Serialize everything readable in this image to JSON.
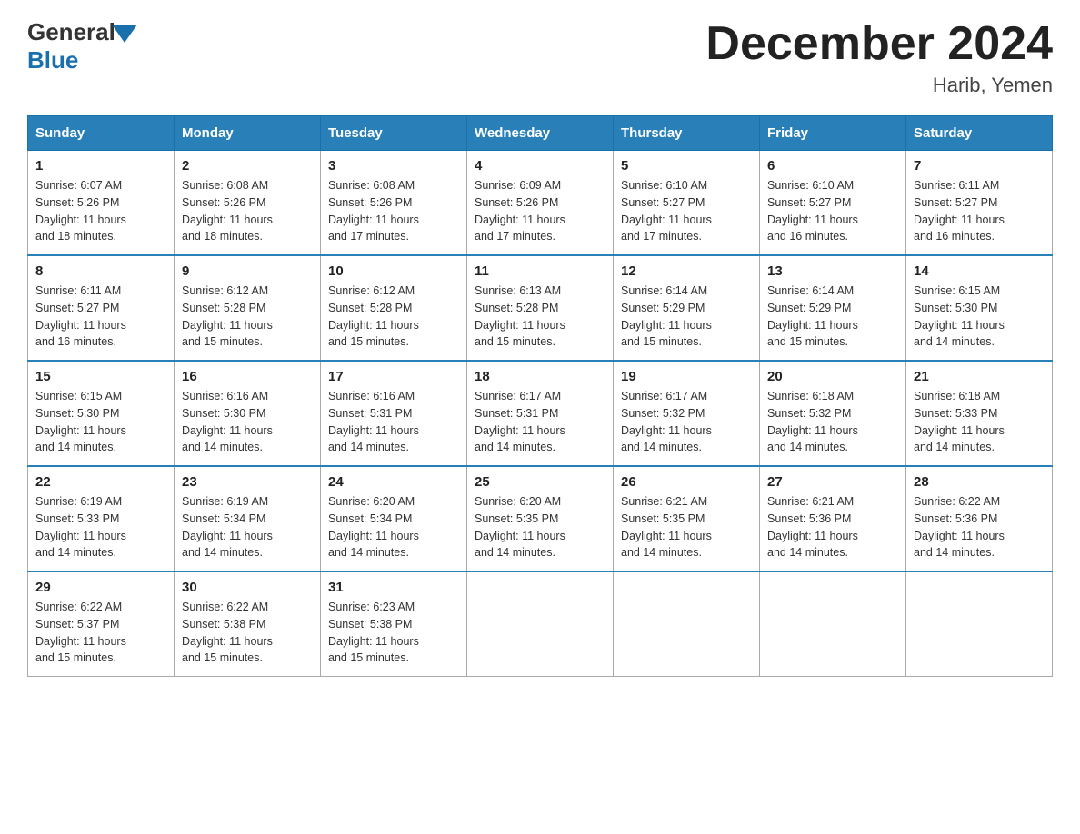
{
  "logo": {
    "general": "General",
    "blue": "Blue"
  },
  "title": "December 2024",
  "subtitle": "Harib, Yemen",
  "days_of_week": [
    "Sunday",
    "Monday",
    "Tuesday",
    "Wednesday",
    "Thursday",
    "Friday",
    "Saturday"
  ],
  "weeks": [
    [
      {
        "day": "1",
        "sunrise": "6:07 AM",
        "sunset": "5:26 PM",
        "daylight": "11 hours and 18 minutes."
      },
      {
        "day": "2",
        "sunrise": "6:08 AM",
        "sunset": "5:26 PM",
        "daylight": "11 hours and 18 minutes."
      },
      {
        "day": "3",
        "sunrise": "6:08 AM",
        "sunset": "5:26 PM",
        "daylight": "11 hours and 17 minutes."
      },
      {
        "day": "4",
        "sunrise": "6:09 AM",
        "sunset": "5:26 PM",
        "daylight": "11 hours and 17 minutes."
      },
      {
        "day": "5",
        "sunrise": "6:10 AM",
        "sunset": "5:27 PM",
        "daylight": "11 hours and 17 minutes."
      },
      {
        "day": "6",
        "sunrise": "6:10 AM",
        "sunset": "5:27 PM",
        "daylight": "11 hours and 16 minutes."
      },
      {
        "day": "7",
        "sunrise": "6:11 AM",
        "sunset": "5:27 PM",
        "daylight": "11 hours and 16 minutes."
      }
    ],
    [
      {
        "day": "8",
        "sunrise": "6:11 AM",
        "sunset": "5:27 PM",
        "daylight": "11 hours and 16 minutes."
      },
      {
        "day": "9",
        "sunrise": "6:12 AM",
        "sunset": "5:28 PM",
        "daylight": "11 hours and 15 minutes."
      },
      {
        "day": "10",
        "sunrise": "6:12 AM",
        "sunset": "5:28 PM",
        "daylight": "11 hours and 15 minutes."
      },
      {
        "day": "11",
        "sunrise": "6:13 AM",
        "sunset": "5:28 PM",
        "daylight": "11 hours and 15 minutes."
      },
      {
        "day": "12",
        "sunrise": "6:14 AM",
        "sunset": "5:29 PM",
        "daylight": "11 hours and 15 minutes."
      },
      {
        "day": "13",
        "sunrise": "6:14 AM",
        "sunset": "5:29 PM",
        "daylight": "11 hours and 15 minutes."
      },
      {
        "day": "14",
        "sunrise": "6:15 AM",
        "sunset": "5:30 PM",
        "daylight": "11 hours and 14 minutes."
      }
    ],
    [
      {
        "day": "15",
        "sunrise": "6:15 AM",
        "sunset": "5:30 PM",
        "daylight": "11 hours and 14 minutes."
      },
      {
        "day": "16",
        "sunrise": "6:16 AM",
        "sunset": "5:30 PM",
        "daylight": "11 hours and 14 minutes."
      },
      {
        "day": "17",
        "sunrise": "6:16 AM",
        "sunset": "5:31 PM",
        "daylight": "11 hours and 14 minutes."
      },
      {
        "day": "18",
        "sunrise": "6:17 AM",
        "sunset": "5:31 PM",
        "daylight": "11 hours and 14 minutes."
      },
      {
        "day": "19",
        "sunrise": "6:17 AM",
        "sunset": "5:32 PM",
        "daylight": "11 hours and 14 minutes."
      },
      {
        "day": "20",
        "sunrise": "6:18 AM",
        "sunset": "5:32 PM",
        "daylight": "11 hours and 14 minutes."
      },
      {
        "day": "21",
        "sunrise": "6:18 AM",
        "sunset": "5:33 PM",
        "daylight": "11 hours and 14 minutes."
      }
    ],
    [
      {
        "day": "22",
        "sunrise": "6:19 AM",
        "sunset": "5:33 PM",
        "daylight": "11 hours and 14 minutes."
      },
      {
        "day": "23",
        "sunrise": "6:19 AM",
        "sunset": "5:34 PM",
        "daylight": "11 hours and 14 minutes."
      },
      {
        "day": "24",
        "sunrise": "6:20 AM",
        "sunset": "5:34 PM",
        "daylight": "11 hours and 14 minutes."
      },
      {
        "day": "25",
        "sunrise": "6:20 AM",
        "sunset": "5:35 PM",
        "daylight": "11 hours and 14 minutes."
      },
      {
        "day": "26",
        "sunrise": "6:21 AM",
        "sunset": "5:35 PM",
        "daylight": "11 hours and 14 minutes."
      },
      {
        "day": "27",
        "sunrise": "6:21 AM",
        "sunset": "5:36 PM",
        "daylight": "11 hours and 14 minutes."
      },
      {
        "day": "28",
        "sunrise": "6:22 AM",
        "sunset": "5:36 PM",
        "daylight": "11 hours and 14 minutes."
      }
    ],
    [
      {
        "day": "29",
        "sunrise": "6:22 AM",
        "sunset": "5:37 PM",
        "daylight": "11 hours and 15 minutes."
      },
      {
        "day": "30",
        "sunrise": "6:22 AM",
        "sunset": "5:38 PM",
        "daylight": "11 hours and 15 minutes."
      },
      {
        "day": "31",
        "sunrise": "6:23 AM",
        "sunset": "5:38 PM",
        "daylight": "11 hours and 15 minutes."
      },
      null,
      null,
      null,
      null
    ]
  ],
  "labels": {
    "sunrise": "Sunrise:",
    "sunset": "Sunset:",
    "daylight": "Daylight:"
  },
  "accent_color": "#2980b9"
}
